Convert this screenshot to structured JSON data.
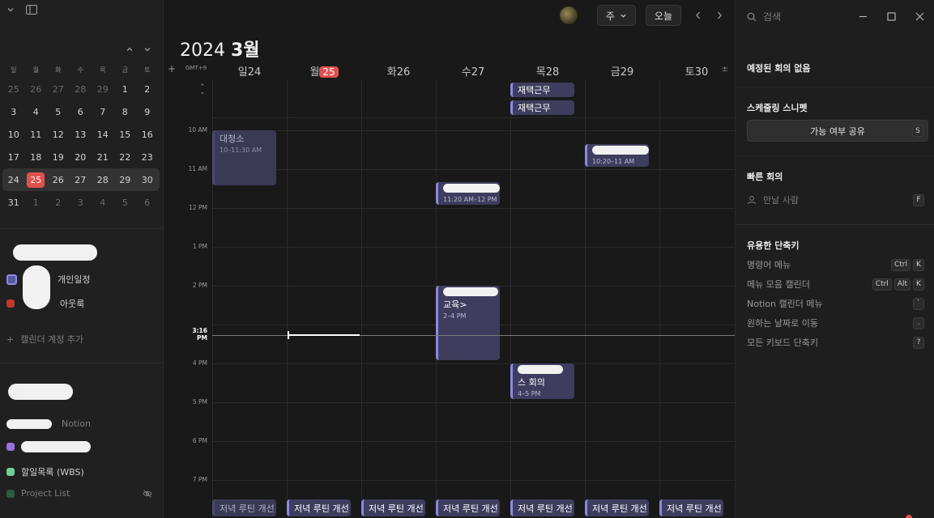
{
  "sidebar": {
    "mini_cal": {
      "weekdays": [
        "일",
        "월",
        "화",
        "수",
        "목",
        "금",
        "토"
      ],
      "weeks": [
        [
          "25",
          "26",
          "27",
          "28",
          "29",
          "1",
          "2"
        ],
        [
          "3",
          "4",
          "5",
          "6",
          "7",
          "8",
          "9"
        ],
        [
          "10",
          "11",
          "12",
          "13",
          "14",
          "15",
          "16"
        ],
        [
          "17",
          "18",
          "19",
          "20",
          "21",
          "22",
          "23"
        ],
        [
          "24",
          "25",
          "26",
          "27",
          "28",
          "29",
          "30"
        ],
        [
          "31",
          "1",
          "2",
          "3",
          "4",
          "5",
          "6"
        ]
      ]
    },
    "cal1_label": "개인일정",
    "cal2_label": "아웃룩",
    "add_account": "캘린더 계정 추가",
    "notion_label": "Notion",
    "db1_label": "할일목록 (WBS)",
    "db2_label": "Project List",
    "colors": {
      "accent": "#8c88e6",
      "purple": "#9a6fe0",
      "green": "#6fcf97",
      "outlook": "#c0392b",
      "dim_green": "#2f5a40"
    }
  },
  "main": {
    "view_label": "주",
    "today_label": "오늘",
    "year": "2024",
    "month": "3월",
    "tz": "GMT+9",
    "days": [
      {
        "wd": "일",
        "d": "24"
      },
      {
        "wd": "월",
        "d": "25"
      },
      {
        "wd": "화",
        "d": "26"
      },
      {
        "wd": "수",
        "d": "27"
      },
      {
        "wd": "목",
        "d": "28"
      },
      {
        "wd": "금",
        "d": "29"
      },
      {
        "wd": "토",
        "d": "30"
      }
    ],
    "hours": [
      "10 AM",
      "11 AM",
      "12 PM",
      "1 PM",
      "2 PM",
      "3 PM",
      "4 PM",
      "5 PM",
      "6 PM",
      "7 PM"
    ],
    "now_label": "3:16 PM",
    "events": {
      "allday1": "재택근무",
      "allday2": "재택근무",
      "ev1_title": "대청소",
      "ev1_time": "10–11:30 AM",
      "ev2_time": "10:20–11 AM",
      "ev3_time": "11:20 AM–12 PM",
      "ev4_title": "교육>",
      "ev4_time": "2–4 PM",
      "ev5_title": "스 회의",
      "ev5_time": "4–5 PM",
      "routine": "저녁 루틴 개선"
    }
  },
  "right": {
    "search_placeholder": "검색",
    "no_meetings": "예정된 회의 없음",
    "scheduling_title": "스케줄링 스니펫",
    "share_label": "가능 여부 공유",
    "share_key": "S",
    "quick_title": "빠른 회의",
    "meet_with": "만날 사람",
    "meet_key": "F",
    "shortcuts_title": "유용한 단축키",
    "shortcuts": [
      {
        "label": "명령어 메뉴",
        "keys": [
          "Ctrl",
          "K"
        ]
      },
      {
        "label": "메뉴 모음 캘린더",
        "keys": [
          "Ctrl",
          "Alt",
          "K"
        ]
      },
      {
        "label": "Notion 캘린더 메뉴",
        "keys": [
          "`"
        ]
      },
      {
        "label": "원하는 날짜로 이동",
        "keys": [
          "."
        ]
      },
      {
        "label": "모든 키보드 단축키",
        "keys": [
          "?"
        ]
      }
    ]
  }
}
